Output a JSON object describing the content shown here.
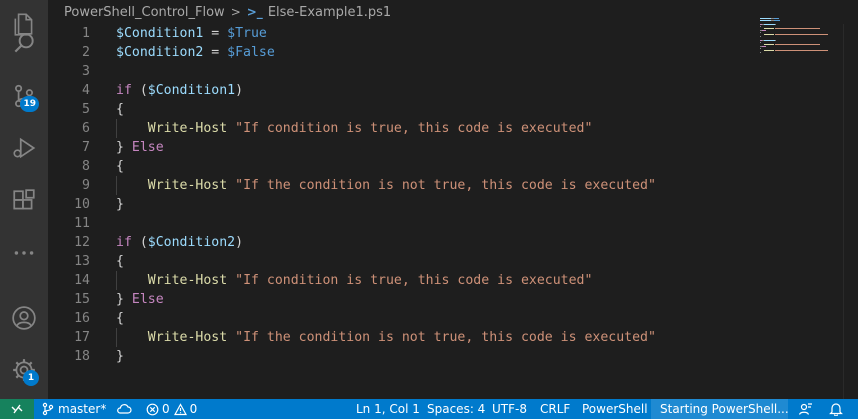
{
  "breadcrumb": {
    "folder": "PowerShell_Control_Flow",
    "separator": ">",
    "file_icon": ">_",
    "file": "Else-Example1.ps1"
  },
  "activity_bar": {
    "source_control_badge": "19",
    "settings_badge": "1"
  },
  "editor": {
    "lines": [
      {
        "n": "1",
        "tokens": [
          [
            "var",
            "$Condition1"
          ],
          [
            "op",
            " = "
          ],
          [
            "const",
            "$True"
          ]
        ]
      },
      {
        "n": "2",
        "tokens": [
          [
            "var",
            "$Condition2"
          ],
          [
            "op",
            " = "
          ],
          [
            "const",
            "$False"
          ]
        ]
      },
      {
        "n": "3",
        "tokens": []
      },
      {
        "n": "4",
        "tokens": [
          [
            "kw",
            "if"
          ],
          [
            "op",
            " ("
          ],
          [
            "var",
            "$Condition1"
          ],
          [
            "op",
            ")"
          ]
        ]
      },
      {
        "n": "5",
        "tokens": [
          [
            "op",
            "{"
          ]
        ]
      },
      {
        "n": "6",
        "tokens": [
          [
            "op",
            "    "
          ],
          [
            "fn",
            "Write-Host"
          ],
          [
            "op",
            " "
          ],
          [
            "str",
            "\"If condition is true, this code is executed\""
          ]
        ]
      },
      {
        "n": "7",
        "tokens": [
          [
            "op",
            "} "
          ],
          [
            "kw",
            "Else"
          ]
        ]
      },
      {
        "n": "8",
        "tokens": [
          [
            "op",
            "{"
          ]
        ]
      },
      {
        "n": "9",
        "tokens": [
          [
            "op",
            "    "
          ],
          [
            "fn",
            "Write-Host"
          ],
          [
            "op",
            " "
          ],
          [
            "str",
            "\"If the condition is not true, this code is executed\""
          ]
        ]
      },
      {
        "n": "10",
        "tokens": [
          [
            "op",
            "}"
          ]
        ]
      },
      {
        "n": "11",
        "tokens": []
      },
      {
        "n": "12",
        "tokens": [
          [
            "kw",
            "if"
          ],
          [
            "op",
            " ("
          ],
          [
            "var",
            "$Condition2"
          ],
          [
            "op",
            ")"
          ]
        ]
      },
      {
        "n": "13",
        "tokens": [
          [
            "op",
            "{"
          ]
        ]
      },
      {
        "n": "14",
        "tokens": [
          [
            "op",
            "    "
          ],
          [
            "fn",
            "Write-Host"
          ],
          [
            "op",
            " "
          ],
          [
            "str",
            "\"If condition is true, this code is executed\""
          ]
        ]
      },
      {
        "n": "15",
        "tokens": [
          [
            "op",
            "} "
          ],
          [
            "kw",
            "Else"
          ]
        ]
      },
      {
        "n": "16",
        "tokens": [
          [
            "op",
            "{"
          ]
        ]
      },
      {
        "n": "17",
        "tokens": [
          [
            "op",
            "    "
          ],
          [
            "fn",
            "Write-Host"
          ],
          [
            "op",
            " "
          ],
          [
            "str",
            "\"If the condition is not true, this code is executed\""
          ]
        ]
      },
      {
        "n": "18",
        "tokens": [
          [
            "op",
            "}"
          ]
        ]
      }
    ]
  },
  "statusbar": {
    "branch": "master*",
    "errors": "0",
    "warnings": "0",
    "position": "Ln 1, Col 1",
    "spaces": "Spaces: 4",
    "encoding": "UTF-8",
    "eol": "CRLF",
    "language": "PowerShell",
    "starting": "Starting PowerShell..."
  },
  "colors": {
    "statusbar": "#007acc",
    "activity_bar": "#333333",
    "editor_bg": "#1e1e1e",
    "keyword": "#c586c0",
    "variable": "#9cdcfe",
    "constant": "#569cd6",
    "function": "#dcdcaa",
    "string": "#ce9178"
  }
}
